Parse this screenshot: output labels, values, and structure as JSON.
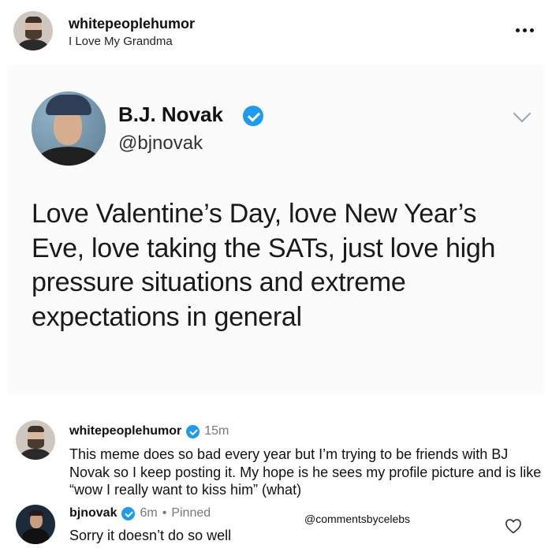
{
  "post": {
    "username": "whitepeoplehumor",
    "subtitle": "I Love My Grandma"
  },
  "tweet": {
    "name": "B.J. Novak",
    "handle": "@bjnovak",
    "text": "Love Valentine’s Day, love New Year’s Eve, love taking the SATs, just love high pressure situations and extreme expectations in general"
  },
  "comments": [
    {
      "username": "whitepeoplehumor",
      "time": "15m",
      "text": "This meme does so bad every year but I’m trying to be friends with BJ Novak so I keep posting it. My hope is he sees my profile picture and is like “wow I really want to kiss him” (what)"
    },
    {
      "username": "bjnovak",
      "time": "6m",
      "separator": "•",
      "pinned": "Pinned",
      "text": "Sorry it doesn’t do so well"
    }
  ],
  "watermark": "@commentsbycelebs",
  "colors": {
    "verified": "#1d9bf0",
    "meta_gray": "#777777"
  }
}
